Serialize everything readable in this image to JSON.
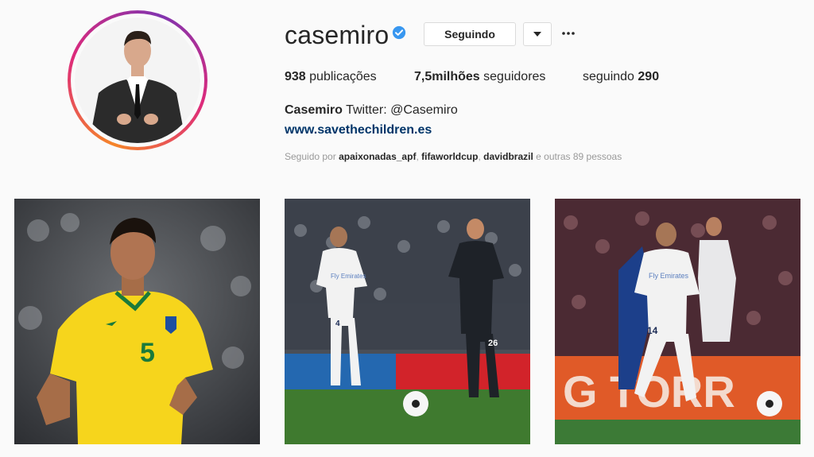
{
  "profile": {
    "username": "casemiro",
    "follow_button": "Seguindo",
    "stats": {
      "posts_count": "938",
      "posts_label": " publicações",
      "followers_count": "7,5milhões",
      "followers_label": " seguidores",
      "following_label": "seguindo ",
      "following_count": "290"
    },
    "bio_name": "Casemiro",
    "bio_text": " Twitter: @Casemiro",
    "website": "www.savethechildren.es",
    "followed_by_prefix": "Seguido por ",
    "followed_by_1": "apaixonadas_apf",
    "followed_by_sep1": ", ",
    "followed_by_2": "fifaworldcup",
    "followed_by_sep2": ", ",
    "followed_by_3": "davidbrazil",
    "followed_by_suffix": " e outras 89 pessoas"
  },
  "posts": [
    {
      "jersey_number": "5",
      "jersey_color": "#f6d51c"
    },
    {
      "jersey_number_1": "4",
      "jersey_number_2": "26",
      "sponsor": "Fly Emirates"
    },
    {
      "jersey_number": "14",
      "sponsor": "Fly Emirates",
      "board_text": "G TORR"
    }
  ],
  "icons": {
    "verified": "verified-badge-icon",
    "caret": "chevron-down-icon",
    "more": "more-options-icon"
  },
  "colors": {
    "link": "#003569",
    "verified": "#3897f0",
    "muted": "#999999"
  }
}
